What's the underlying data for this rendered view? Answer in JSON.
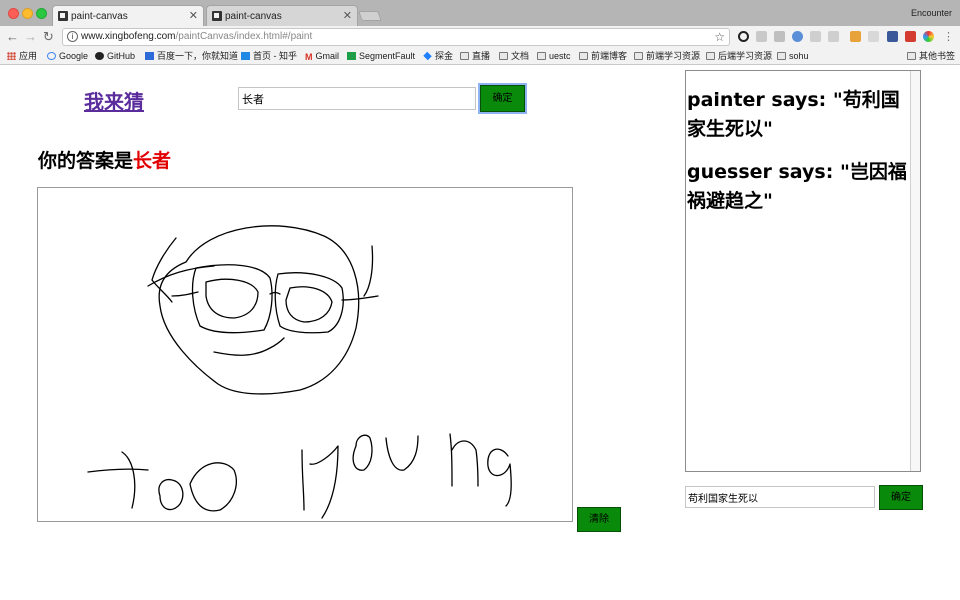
{
  "browser": {
    "tabs": [
      {
        "label": "paint-canvas"
      },
      {
        "label": "paint-canvas"
      }
    ],
    "profile_name": "Encounter",
    "url_host": "www.xingbofeng.com",
    "url_path": "/paintCanvas/index.html#/paint",
    "bookmarks": [
      {
        "label": "应用",
        "icon": "apps-icon"
      },
      {
        "label": "Google",
        "icon": "google-icon"
      },
      {
        "label": "GitHub",
        "icon": "github-icon"
      },
      {
        "label": "百度一下，你就知道",
        "icon": "baidu-icon"
      },
      {
        "label": "首页 - 知乎",
        "icon": "zhihu-icon"
      },
      {
        "label": "Gmail",
        "icon": "gmail-icon"
      },
      {
        "label": "SegmentFault",
        "icon": "segmentfault-icon"
      },
      {
        "label": "探金",
        "icon": "juejin-icon"
      },
      {
        "label": "直播",
        "icon": "folder-icon"
      },
      {
        "label": "文档",
        "icon": "folder-icon"
      },
      {
        "label": "uestc",
        "icon": "folder-icon"
      },
      {
        "label": "前端博客",
        "icon": "folder-icon"
      },
      {
        "label": "前端学习资源",
        "icon": "folder-icon"
      },
      {
        "label": "后端学习资源",
        "icon": "folder-icon"
      },
      {
        "label": "sohu",
        "icon": "folder-icon"
      }
    ],
    "other_bookmarks": "其他书签"
  },
  "game": {
    "title": "我来猜",
    "answer_input_value": "长者",
    "confirm_label": "确定",
    "answer_prefix": "你的答案是",
    "answer_value": "长者",
    "clear_label": "清除",
    "drawing_text": "too young"
  },
  "chat": {
    "messages": [
      {
        "text": "painter says: \"苟利国家生死以\""
      },
      {
        "text": "guesser says: \"岂因福祸避趋之\""
      }
    ],
    "input_value": "苟利国家生死以",
    "send_label": "确定"
  },
  "colors": {
    "button_green": "#0a8a0a",
    "answer_highlight": "#e30000",
    "link_purple": "#5b2d9c"
  }
}
